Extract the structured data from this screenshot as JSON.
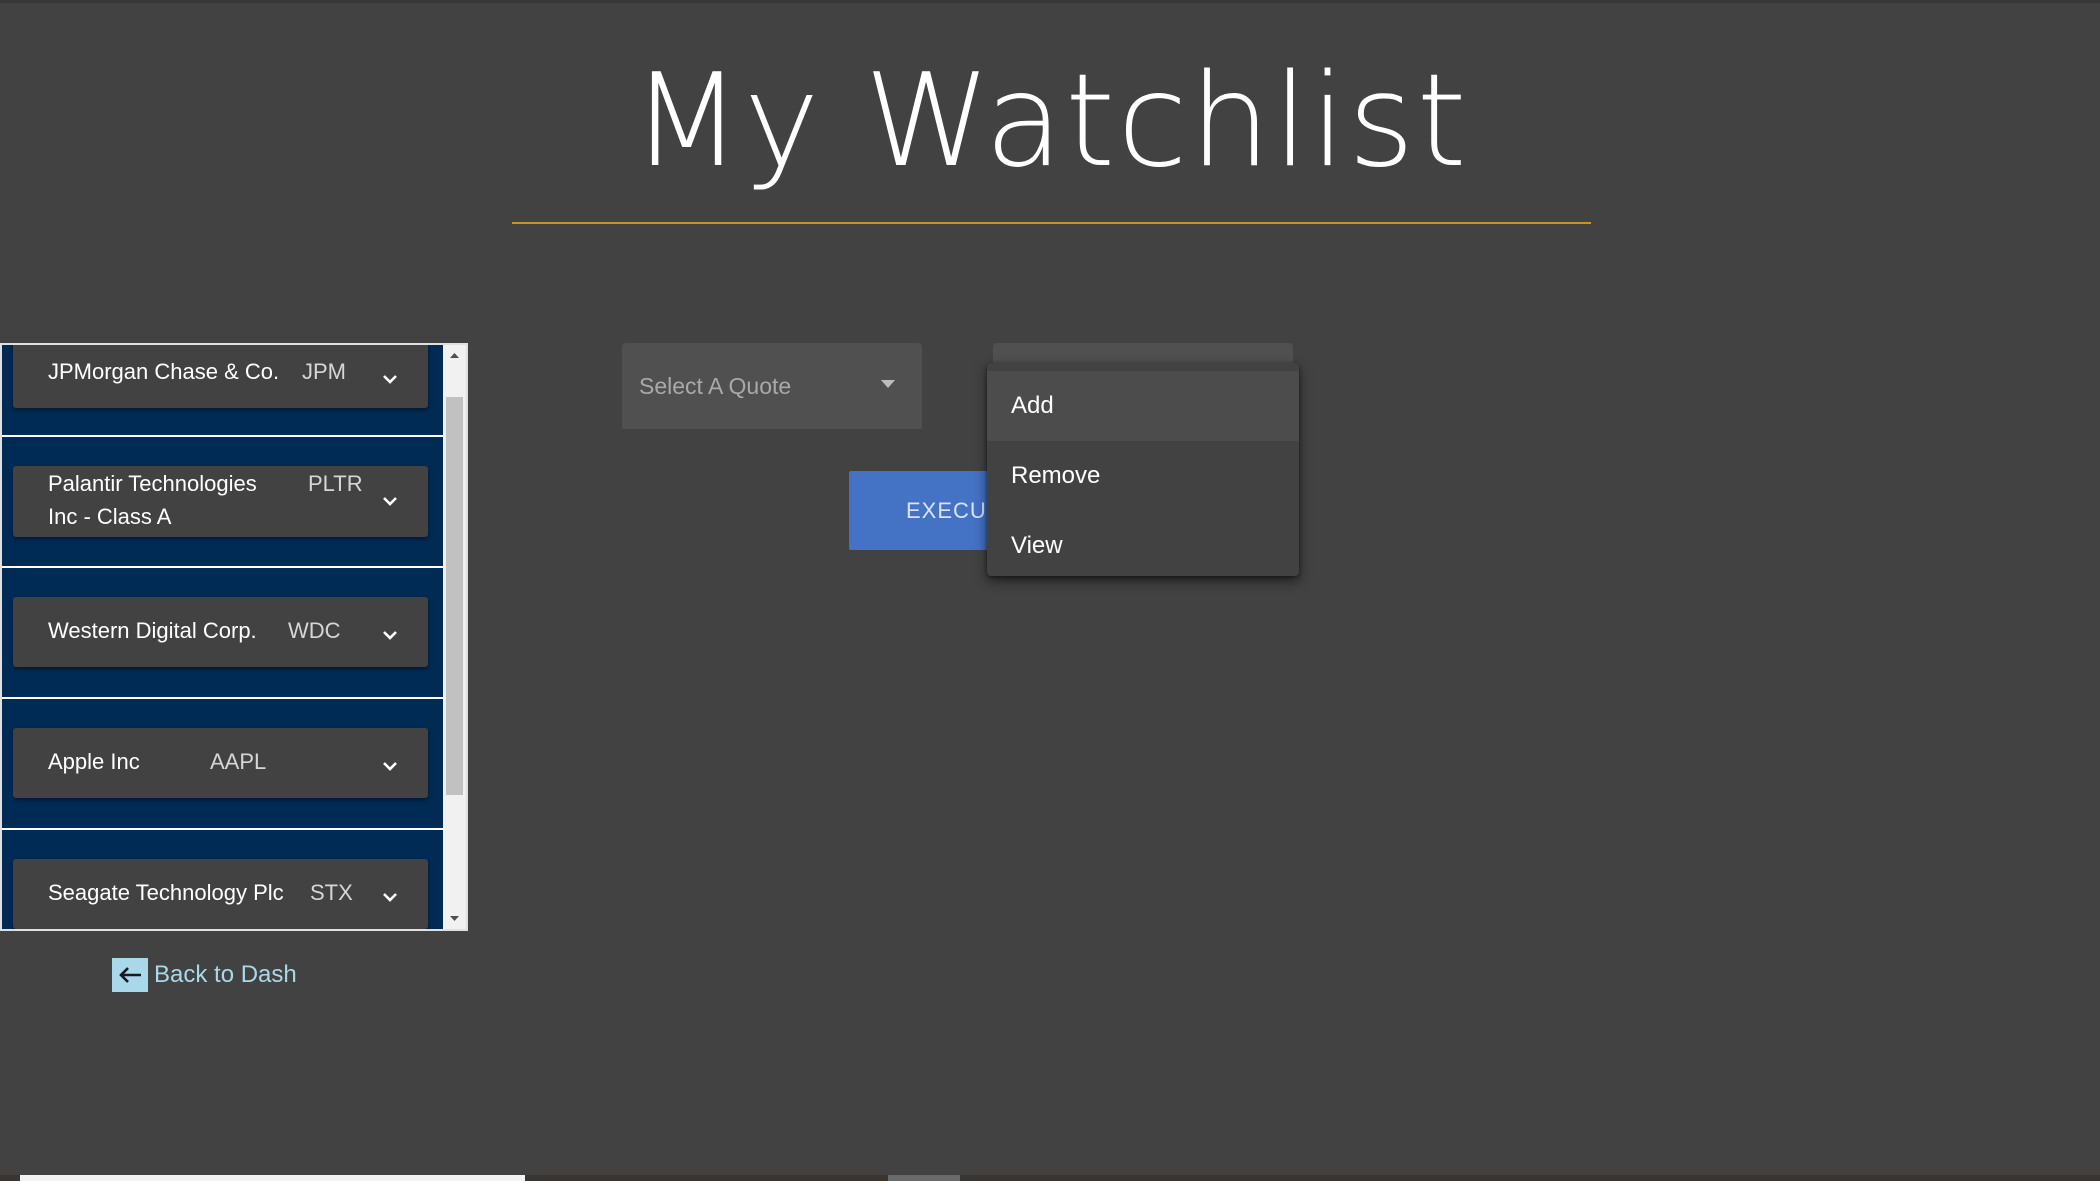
{
  "page": {
    "title": "My Watchlist"
  },
  "watchlist": {
    "items": [
      {
        "name_lines": [
          "JPMorgan Chase & Co."
        ],
        "symbol": "JPM"
      },
      {
        "name_lines": [
          "Palantir Technologies",
          "Inc - Class A"
        ],
        "symbol": "PLTR"
      },
      {
        "name_lines": [
          "Western Digital Corp."
        ],
        "symbol": "WDC"
      },
      {
        "name_lines": [
          "Apple Inc"
        ],
        "symbol": "AAPL"
      },
      {
        "name_lines": [
          "Seagate Technology Plc"
        ],
        "symbol": "STX"
      }
    ]
  },
  "back_link": {
    "label": "Back to Dash"
  },
  "quote_select": {
    "placeholder": "Select A Quote"
  },
  "execute_button": {
    "label": "EXECUTE"
  },
  "action_menu": {
    "items": [
      "Add",
      "Remove",
      "View"
    ],
    "highlighted": "Add"
  },
  "colors": {
    "background": "#424242",
    "title_divider": "#c8961e",
    "list_row": "#002b55",
    "execute": "#4472c4",
    "back_link": "#a8d8ea"
  }
}
